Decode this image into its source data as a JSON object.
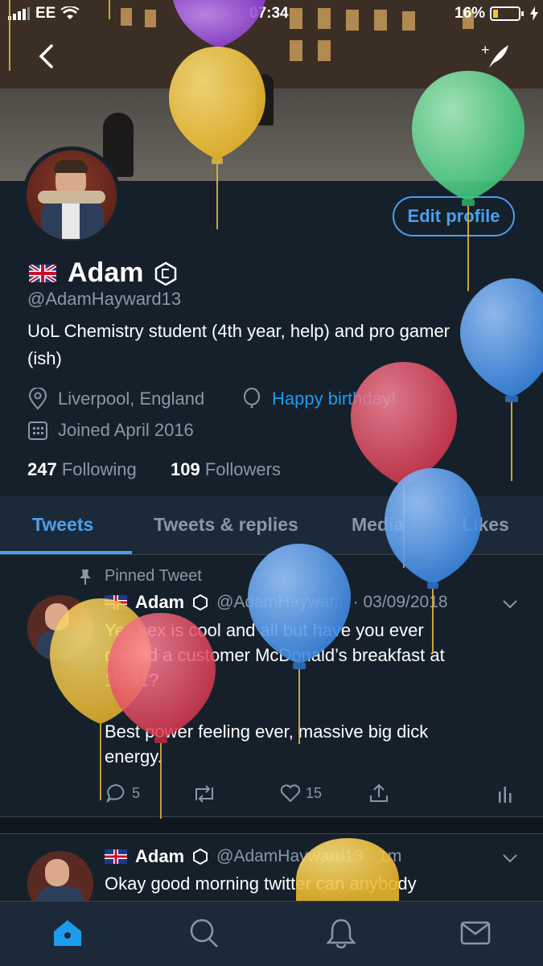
{
  "status_bar": {
    "carrier": "EE",
    "time": "07:34",
    "battery": "16%"
  },
  "header": {
    "back_icon": "chevron-left-icon",
    "compose_icon": "new-tweet-feather-icon"
  },
  "profile": {
    "flag": "uk-flag-icon",
    "name": "Adam",
    "handle": "@AdamHayward13",
    "bio_line1": "UoL Chemistry student (4th year, help) and pro gamer",
    "bio_line2": "(ish)",
    "location": "Liverpool, England",
    "birthday": "Happy birthday!",
    "joined": "Joined April 2016",
    "following_count": "247",
    "following_label": "Following",
    "followers_count": "109",
    "followers_label": "Followers",
    "edit_button": "Edit profile"
  },
  "tabs": [
    "Tweets",
    "Tweets & replies",
    "Media",
    "Likes"
  ],
  "tweets": [
    {
      "pinned_label": "Pinned Tweet",
      "name": "Adam",
      "handle_time": "@AdamHaywar... · 03/09/2018",
      "lines": [
        "Yes sex is cool and all but have you ever",
        "denied a customer McDonald’s breakfast at",
        "10:31?",
        "",
        "Best power feeling ever, massive big dick",
        "energy."
      ],
      "replies": "5",
      "likes": "15"
    },
    {
      "name": "Adam",
      "handle_time": "@AdamHayward13 · 1m",
      "lines": [
        "Okay good morning twitter can anybody"
      ]
    }
  ],
  "nav": [
    "home-icon",
    "search-icon",
    "notifications-bell-icon",
    "messages-mail-icon"
  ],
  "colors": {
    "background": "#15202b",
    "accent": "#1d9bf0",
    "muted": "#8899a6"
  }
}
